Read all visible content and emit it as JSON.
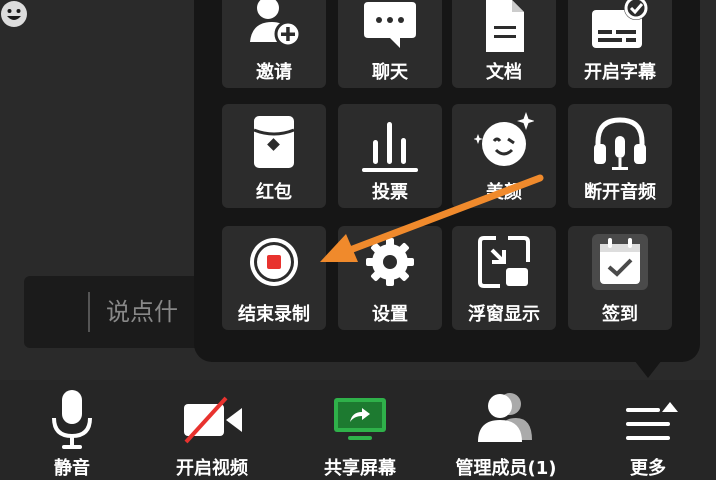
{
  "chat": {
    "placeholder": "说点什"
  },
  "more_panel": {
    "rows": [
      [
        {
          "label": "邀请",
          "icon": "invite-user-icon"
        },
        {
          "label": "聊天",
          "icon": "chat-bubble-icon"
        },
        {
          "label": "文档",
          "icon": "document-icon"
        },
        {
          "label": "开启字幕",
          "icon": "subtitle-icon"
        }
      ],
      [
        {
          "label": "红包",
          "icon": "red-envelope-icon"
        },
        {
          "label": "投票",
          "icon": "vote-chart-icon"
        },
        {
          "label": "美颜",
          "icon": "beauty-face-icon"
        },
        {
          "label": "断开音频",
          "icon": "headphones-icon"
        }
      ],
      [
        {
          "label": "结束录制",
          "icon": "stop-recording-icon"
        },
        {
          "label": "设置",
          "icon": "gear-icon"
        },
        {
          "label": "浮窗显示",
          "icon": "floating-window-icon"
        },
        {
          "label": "签到",
          "icon": "check-in-calendar-icon"
        }
      ]
    ]
  },
  "toolbar": {
    "items": [
      {
        "label": "静音",
        "icon": "microphone-icon"
      },
      {
        "label": "开启视频",
        "icon": "video-off-icon"
      },
      {
        "label": "共享屏幕",
        "icon": "share-screen-icon"
      },
      {
        "label": "管理成员(1)",
        "icon": "members-icon"
      },
      {
        "label": "更多",
        "icon": "more-menu-icon"
      }
    ]
  },
  "colors": {
    "record_red": "#e8322e",
    "share_green": "#2fb14a",
    "arrow_orange": "#f08a2c"
  }
}
